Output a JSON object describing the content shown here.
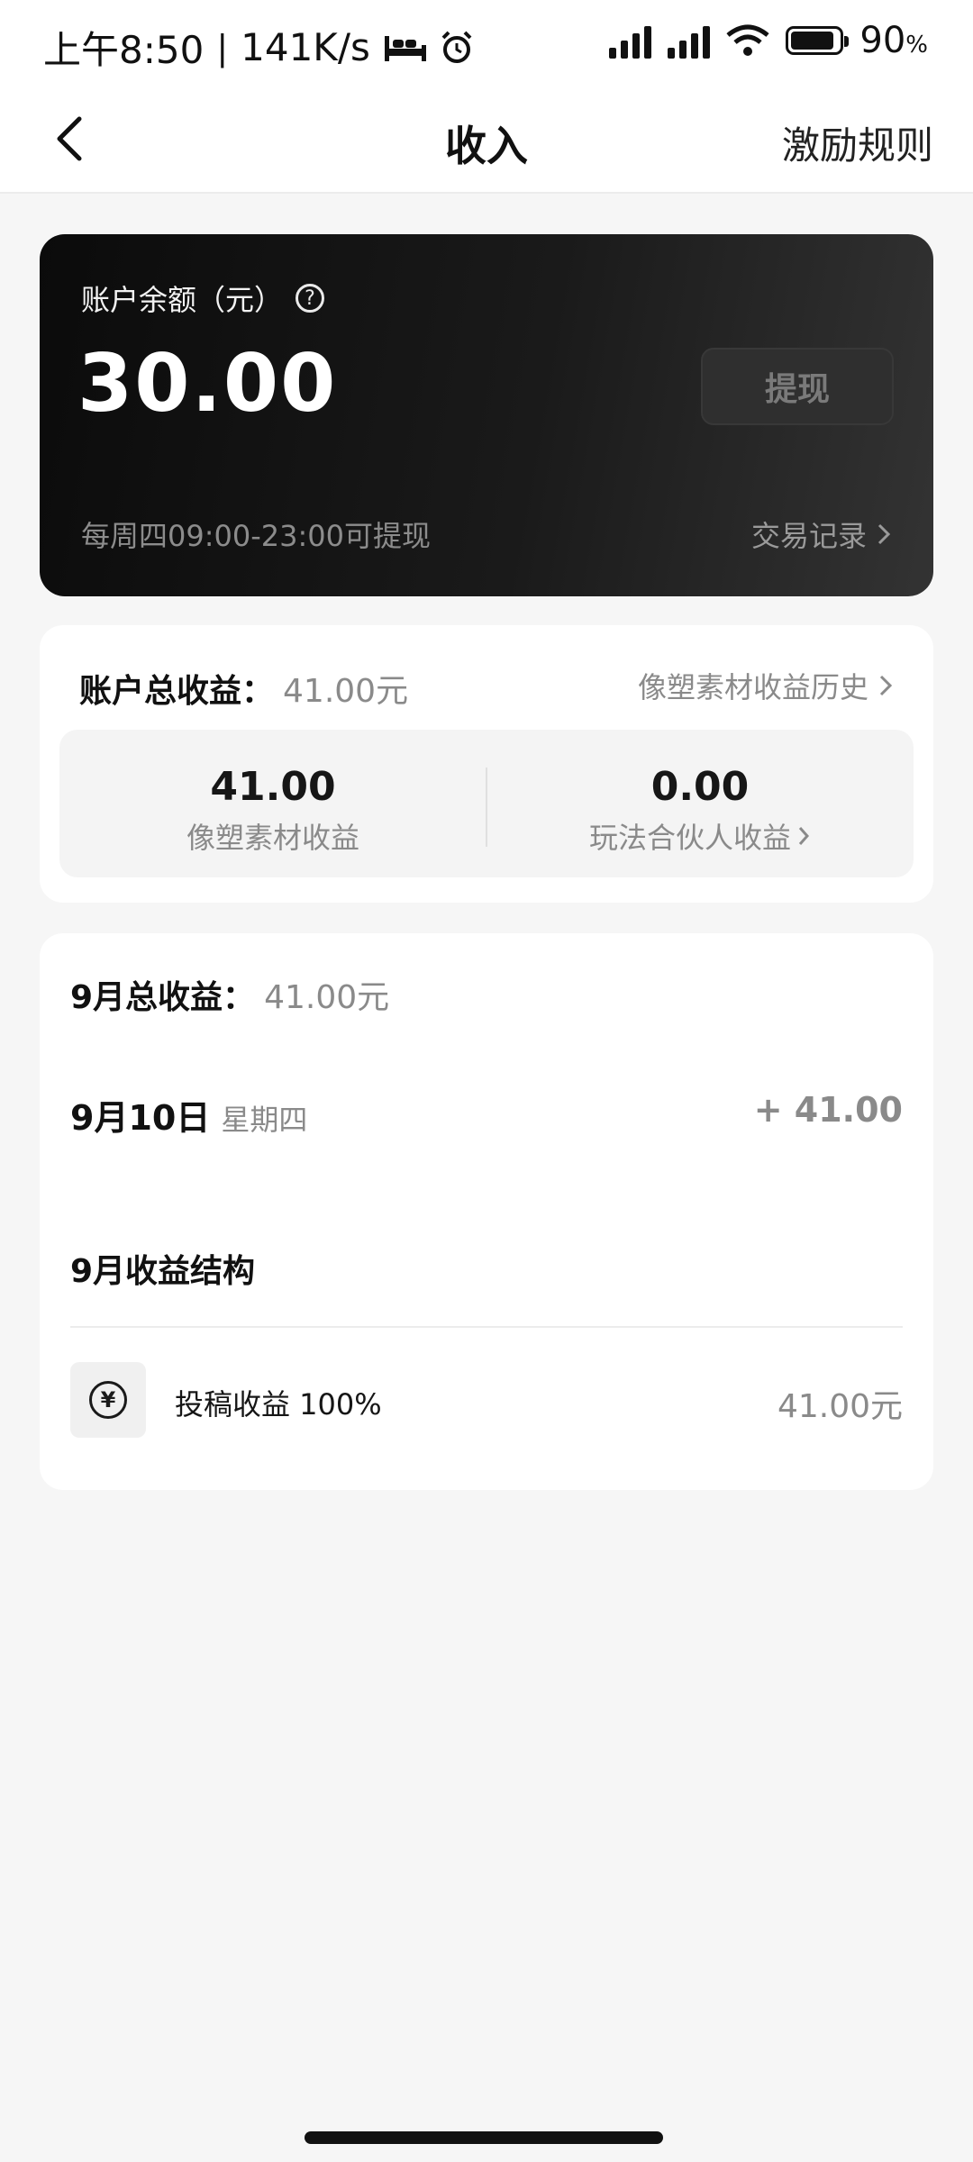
{
  "status_bar": {
    "time": "上午8:50",
    "net_speed": "141K/s",
    "battery": "90",
    "battery_unit": "%",
    "battery_level": 0.9
  },
  "nav": {
    "title": "收入",
    "right_link": "激励规则"
  },
  "balance": {
    "label": "账户余额（元）",
    "amount": "30.00",
    "withdraw_label": "提现",
    "note": "每周四09:00-23:00可提现",
    "records_link": "交易记录"
  },
  "total_earnings": {
    "label": "账户总收益：",
    "value": "41.00元",
    "history_link": "像塑素材收益历史",
    "items": [
      {
        "amount": "41.00",
        "label": "像塑素材收益"
      },
      {
        "amount": "0.00",
        "label": "玩法合伙人收益"
      }
    ]
  },
  "month": {
    "title": "9月总收益：",
    "total": "41.00元",
    "day": {
      "date": "9月10日",
      "weekday": "星期四",
      "amount": "+ 41.00"
    },
    "structure_title": "9月收益结构",
    "structure_items": [
      {
        "label": "投稿收益 100%",
        "amount": "41.00元",
        "icon": "yen-icon"
      }
    ]
  },
  "colors": {
    "card_dark": "#0b0b0b",
    "muted_text": "#8a8a8a",
    "page_bg": "#f6f6f6"
  }
}
